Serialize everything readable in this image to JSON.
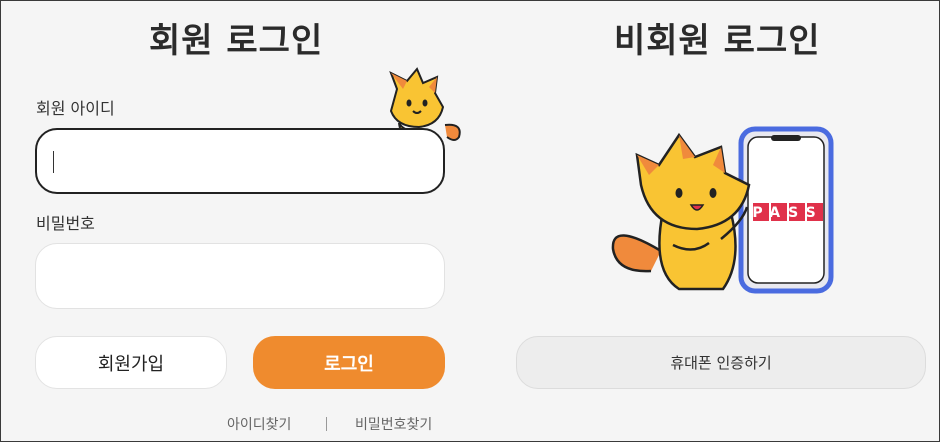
{
  "member": {
    "title": "회원 로그인",
    "id_label": "회원 아이디",
    "id_value": "",
    "password_label": "비밀번호",
    "password_value": "",
    "join_button": "회원가입",
    "login_button": "로그인",
    "find_id_link": "아이디찾기",
    "find_password_link": "비밀번호찾기"
  },
  "guest": {
    "title": "비회원 로그인",
    "phone_auth_button": "휴대폰 인증하기",
    "pass_logo_text": "PASS"
  },
  "colors": {
    "accent": "#ef8b2e",
    "mascot": "#f9c433",
    "pass_red": "#e0314a",
    "phone_frame": "#4a6be0"
  },
  "icons": [
    "mascot-cat-icon",
    "phone-pass-icon"
  ]
}
